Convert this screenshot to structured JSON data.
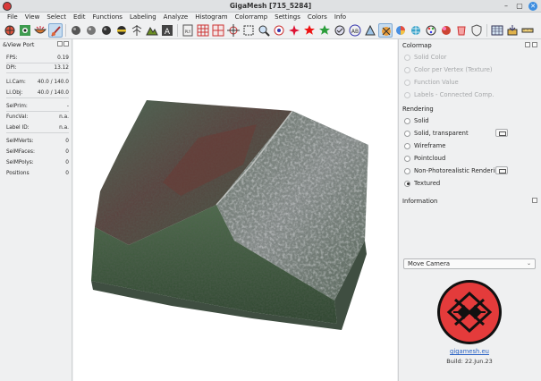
{
  "window": {
    "title": "GigaMesh [715_5284]",
    "minimize": "–",
    "maximize": "▢",
    "close": "✕"
  },
  "menu": [
    "File",
    "View",
    "Select",
    "Edit",
    "Functions",
    "Labeling",
    "Analyze",
    "Histogram",
    "Colorramp",
    "Settings",
    "Colors",
    "Info"
  ],
  "left_panel": {
    "title": "&View Port",
    "stats": [
      {
        "label": "FPS:",
        "value": "0.19"
      },
      {
        "label": "DPI:",
        "value": "13.12"
      },
      {
        "label": "Li.Cam:",
        "value": "40.0 / 140.0"
      },
      {
        "label": "Li.Obj:",
        "value": "40.0 / 140.0"
      },
      {
        "label": "SelPrim:",
        "value": "-"
      },
      {
        "label": "FuncVal:",
        "value": "n.a."
      },
      {
        "label": "Label ID:",
        "value": "n.a."
      },
      {
        "label": "SelMVerts:",
        "value": "0"
      },
      {
        "label": "SelMFaces:",
        "value": "0"
      },
      {
        "label": "SelMPolys:",
        "value": "0"
      },
      {
        "label": "Positions",
        "value": "0"
      }
    ]
  },
  "right_panel": {
    "colormap_title": "Colormap",
    "colormap_options": [
      "Solid Color",
      "Color per Vertex (Texture)",
      "Function Value",
      "Labels - Connected Comp."
    ],
    "rendering_title": "Rendering",
    "rendering_options": [
      "Solid",
      "Solid, transparent",
      "Wireframe",
      "Pointcloud",
      "Non-Photorealistic Rendering",
      "Textured"
    ],
    "rendering_selected": "Textured",
    "information_title": "Information",
    "mouse_mode": "Move Camera",
    "link": "gigamesh.eu",
    "build": "Build: 22.Jun.23"
  },
  "colors": {
    "accent": "#3d8ee0",
    "logo_red": "#e43b3b",
    "link": "#2962c4"
  }
}
